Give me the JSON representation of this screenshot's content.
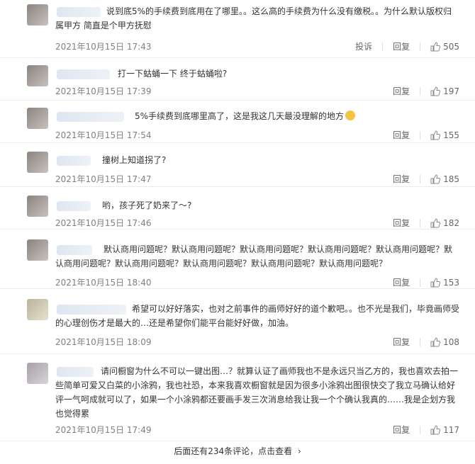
{
  "comments": [
    {
      "text": "说到底5%的手续费到底用在了哪里。。这么高的手续费为什么没有缴税。。为什么默认版权归属甲方 简直是个甲方抚慰",
      "date": "2021年10月15日 17:43",
      "report": "投诉",
      "reply": "回复",
      "likes": "505"
    },
    {
      "text": "打一下蛄蛹一下 终于蛄蛹啦?",
      "date": "2021年10月15日 17:39",
      "reply": "回复",
      "likes": "197"
    },
    {
      "text": "5%手续费到底哪里高了，这是我这几天最没理解的地方",
      "date": "2021年10月15日 17:54",
      "reply": "回复",
      "likes": "155"
    },
    {
      "text": "撞树上知道拐了?",
      "date": "2021年10月15日 17:47",
      "reply": "回复",
      "likes": "185"
    },
    {
      "text": "哟，孩子死了奶来了～?",
      "date": "2021年10月15日 17:46",
      "reply": "回复",
      "likes": "182"
    },
    {
      "text": "默认商用问题呢？默认商用问题呢？默认商用问题呢？默认商用问题呢？默认商用问题呢？默认商用问题呢？默认商用问题呢？默认商用问题呢？默认商用问题呢？默认商用问题呢？",
      "date": "2021年10月15日 18:40",
      "reply": "回复",
      "likes": "153"
    },
    {
      "text": "希望可以好好落实，也对之前事件的画师好好的道个歉吧。。也不光是我们，毕竟画师受的心理创伤才是最大的…还是希望你们能平台能好好做，加油。",
      "date": "2021年10月15日 18:09",
      "reply": "回复",
      "likes": "108"
    },
    {
      "text": "请问橱窗为什么不可以一键出图…？就算认证了画师我也不是永远只当乙方的，我也喜欢去拍一些简单可爱又白菜的小涂鸦，我也社恐，本来我喜欢橱窗就是因为很多小涂鸦出图很快交了我立马确认给好评一气呵成就可以了，如果一个小涂鸦都还要画手发三次消息给我让我一个个确认我真的……我是企划方我也觉得累",
      "date": "2021年10月15日 17:49",
      "reply": "回复",
      "likes": "117"
    }
  ],
  "footer": {
    "text": "后面还有234条评论，点击查看",
    "chevron": "›"
  },
  "icons": {
    "like": "thumbs-up-icon",
    "emoji": "grinning-face-icon"
  }
}
